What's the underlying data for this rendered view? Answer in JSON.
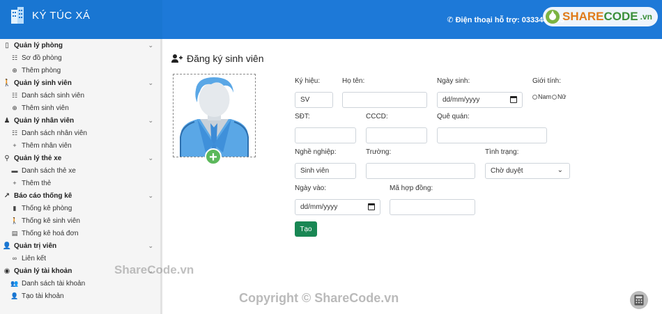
{
  "app": {
    "title": "KÝ TÚC XÁ"
  },
  "header": {
    "support_text": "Điện thoại hỗ trợ: 0333444555"
  },
  "logo": {
    "main": "SHARE",
    "second": "CODE",
    "tld": ".vn"
  },
  "sidebar": {
    "groups": [
      {
        "title": "Quản lý phòng",
        "items": [
          "Sơ đồ phòng",
          "Thêm phòng"
        ]
      },
      {
        "title": "Quản lý sinh viên",
        "items": [
          "Danh sách sinh viên",
          "Thêm sinh viên"
        ]
      },
      {
        "title": "Quản lý nhân viên",
        "items": [
          "Danh sách nhân viên",
          "Thêm nhân viên"
        ]
      },
      {
        "title": "Quản lý thẻ xe",
        "items": [
          "Danh sách thẻ xe",
          "Thêm thẻ"
        ]
      },
      {
        "title": "Báo cáo thống kê",
        "items": [
          "Thống kê phòng",
          "Thống kê sinh viên",
          "Thống kê hoá đơn"
        ]
      },
      {
        "title": "Quản trị viên",
        "items": [
          "Liên kết"
        ]
      },
      {
        "title": "Quản lý tài khoản",
        "items": [
          "Danh sách tài khoản",
          "Tạo tài khoản"
        ]
      }
    ]
  },
  "form": {
    "title": "Đăng ký sinh viên",
    "labels": {
      "symbol": "Ký hiệu:",
      "name": "Họ tên:",
      "dob": "Ngày sinh:",
      "gender": "Giới tính:",
      "phone": "SĐT:",
      "cccd": "CCCD:",
      "hometown": "Quê quán:",
      "job": "Nghề nghiệp:",
      "school": "Trường:",
      "status": "Tình trạng:",
      "start_date": "Ngày vào:",
      "contract": "Mã hợp đồng:"
    },
    "values": {
      "symbol": "SV",
      "dob": "dd/mm/yyyy",
      "job": "Sinh viên",
      "status": "Chờ duyệt",
      "start_date": "dd/mm/yyyy"
    },
    "gender_options": [
      "Nam",
      "Nữ"
    ],
    "submit": "Tạo"
  },
  "watermarks": {
    "a": "ShareCode.vn",
    "b": "Copyright © ShareCode.vn"
  }
}
